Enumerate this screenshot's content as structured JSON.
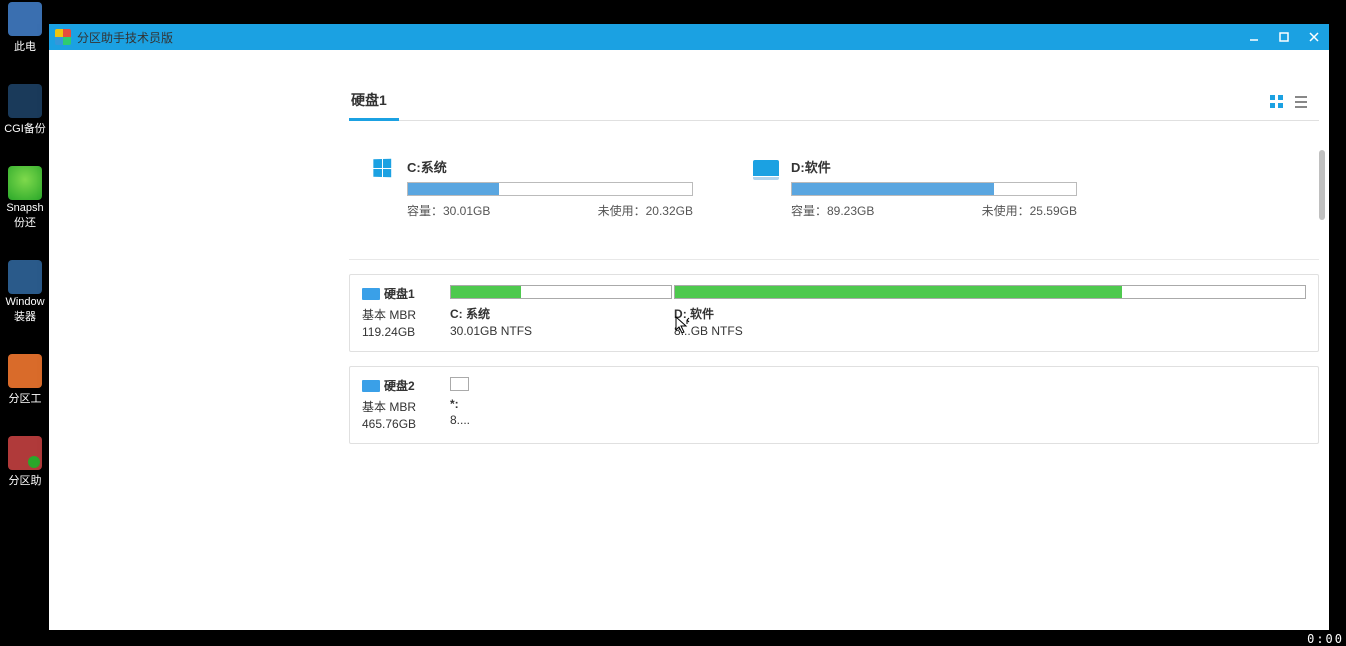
{
  "desktop": {
    "items": [
      {
        "label": "此电",
        "name": "this-pc"
      },
      {
        "label": "CGI备份",
        "name": "cgi-backup"
      },
      {
        "label": "Snapsh\n份还",
        "name": "snapshot-restore"
      },
      {
        "label": "Window\n装器",
        "name": "windows-installer"
      },
      {
        "label": "分区工",
        "name": "partition-tool"
      },
      {
        "label": "分区助",
        "name": "partition-assistant"
      }
    ]
  },
  "window": {
    "title": "分区助手技术员版"
  },
  "header": {
    "title": "硬盘1"
  },
  "partitions_top": [
    {
      "name": "C:系统",
      "capacity_label": "容量：30.01GB",
      "unused_label": "未使用：20.32GB",
      "fill_pct": 32,
      "icon": "windows"
    },
    {
      "name": "D:软件",
      "capacity_label": "容量：89.23GB",
      "unused_label": "未使用：25.59GB",
      "fill_pct": 71,
      "icon": "drive"
    }
  ],
  "disks": [
    {
      "name": "硬盘1",
      "type": "基本 MBR",
      "size": "119.24GB",
      "segments": [
        {
          "width_pct": 26,
          "fill_pct": 32,
          "label": "C: 系统",
          "sub": "30.01GB NTFS"
        },
        {
          "width_pct": 74,
          "fill_pct": 71,
          "label": "D: 软件",
          "sub": "8...GB NTFS"
        }
      ]
    },
    {
      "name": "硬盘2",
      "type": "基本 MBR",
      "size": "465.76GB",
      "segments": [
        {
          "width_pct": 2.2,
          "fill_pct": 0,
          "label": "*:",
          "sub": "8...."
        }
      ]
    }
  ],
  "taskbar": {
    "clock": "0:00"
  }
}
